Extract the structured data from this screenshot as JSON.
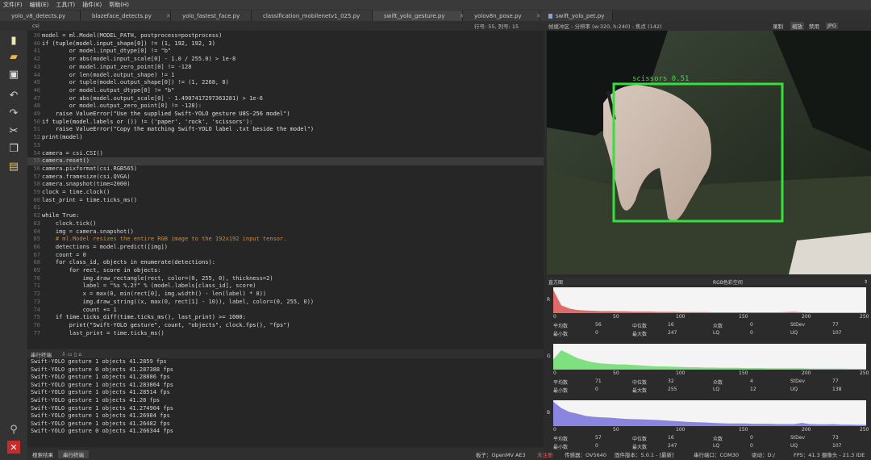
{
  "menu": [
    "文件(F)",
    "编辑(E)",
    "工具(T)",
    "插件(K)",
    "帮助(H)"
  ],
  "tabs": [
    {
      "label": "yolo_v8_detects.py"
    },
    {
      "label": "blazeface_detects.py"
    },
    {
      "label": "yolo_fastest_face.py"
    },
    {
      "label": "classification_mobilenetv1_025.py"
    },
    {
      "label": "swift_yolo_gesture.py"
    },
    {
      "label": "yolov8n_pose.py"
    },
    {
      "label": "swift_yolo_pet.py"
    }
  ],
  "editor_tab": "csi",
  "cursor_info": "行号: 55, 列号: 15",
  "fb_info": "帧缓冲区 - 分辨率 (w:320, h:240) - 焦点 (142)",
  "fb_buttons": [
    "录制",
    "缩放",
    "禁用",
    "JPG"
  ],
  "code_lines": [
    {
      "n": "39",
      "t": "model = ml.Model(MODEL_PATH, postprocess=postprocess)"
    },
    {
      "n": "40",
      "t": "if (tuple(model.input_shape[0]) != (1, 192, 192, 3)"
    },
    {
      "n": "41",
      "t": "        or model.input_dtype[0] != \"b\""
    },
    {
      "n": "42",
      "t": "        or abs(model.input_scale[0] - 1.0 / 255.0) > 1e-8"
    },
    {
      "n": "43",
      "t": "        or model.input_zero_point[0] != -128"
    },
    {
      "n": "44",
      "t": "        or len(model.output_shape) != 1"
    },
    {
      "n": "45",
      "t": "        or tuple(model.output_shape[0]) != (1, 2268, 8)"
    },
    {
      "n": "46",
      "t": "        or model.output_dtype[0] != \"b\""
    },
    {
      "n": "47",
      "t": "        or abs(model.output_scale[0] - 1.4907417297363281) > 1e-6"
    },
    {
      "n": "48",
      "t": "        or model.output_zero_point[0] != -128):"
    },
    {
      "n": "49",
      "t": "    raise ValueError(\"Use the supplied Swift-YOLO gesture U8S-256 model\")"
    },
    {
      "n": "50",
      "t": "if tuple(model.labels or ()) != ('paper', 'rock', 'scissors'):"
    },
    {
      "n": "51",
      "t": "    raise ValueError(\"Copy the matching Swift-YOLO label .txt beside the model\")"
    },
    {
      "n": "52",
      "t": "print(model)"
    },
    {
      "n": "53",
      "t": ""
    },
    {
      "n": "54",
      "t": "camera = csi.CSI()"
    },
    {
      "n": "55",
      "t": "camera.reset()"
    },
    {
      "n": "56",
      "t": "camera.pixformat(csi.RGB565)"
    },
    {
      "n": "57",
      "t": "camera.framesize(csi.QVGA)"
    },
    {
      "n": "58",
      "t": "camera.snapshot(time=2000)"
    },
    {
      "n": "59",
      "t": "clock = time.clock()"
    },
    {
      "n": "60",
      "t": "last_print = time.ticks_ms()"
    },
    {
      "n": "61",
      "t": ""
    },
    {
      "n": "62",
      "t": "while True:"
    },
    {
      "n": "63",
      "t": "    clock.tick()"
    },
    {
      "n": "64",
      "t": "    img = camera.snapshot()"
    },
    {
      "n": "65",
      "t": "    # ml.Model resizes the entire RGB image to the 192x192 input tensor."
    },
    {
      "n": "66",
      "t": "    detections = model.predict([img])"
    },
    {
      "n": "67",
      "t": "    count = 0"
    },
    {
      "n": "68",
      "t": "    for class_id, objects in enumerate(detections):"
    },
    {
      "n": "69",
      "t": "        for rect, score in objects:"
    },
    {
      "n": "70",
      "t": "            img.draw_rectangle(rect, color=(0, 255, 0), thickness=2)"
    },
    {
      "n": "71",
      "t": "            label = \"%s %.2f\" % (model.labels[class_id], score)"
    },
    {
      "n": "72",
      "t": "            x = max(0, min(rect[0], img.width() - len(label) * 8))"
    },
    {
      "n": "73",
      "t": "            img.draw_string((x, max(0, rect[1] - 10)), label, color=(0, 255, 0))"
    },
    {
      "n": "74",
      "t": "            count += 1"
    },
    {
      "n": "75",
      "t": "    if time.ticks_diff(time.ticks_ms(), last_print) >= 1000:"
    },
    {
      "n": "76",
      "t": "        print(\"Swift-YOLO gesture\", count, \"objects\", clock.fps(), \"fps\")"
    },
    {
      "n": "77",
      "t": "        last_print = time.ticks_ms()"
    }
  ],
  "terminal_title": "串行终端",
  "terminal_lines": [
    "Swift-YOLO gesture 1 objects 41.2859 fps",
    "Swift-YOLO gesture 0 objects 41.287388 fps",
    "Swift-YOLO gesture 1 objects 41.28886 fps",
    "Swift-YOLO gesture 1 objects 41.283864 fps",
    "Swift-YOLO gesture 1 objects 41.28514 fps",
    "Swift-YOLO gesture 1 objects 41.28 fps",
    "Swift-YOLO gesture 1 objects 41.274904 fps",
    "Swift-YOLO gesture 1 objects 41.26984 fps",
    "Swift-YOLO gesture 1 objects 41.26482 fps",
    "Swift-YOLO gesture 0 objects 41.266344 fps"
  ],
  "bottom_tabs": [
    "搜索结果",
    "串行终端"
  ],
  "status": {
    "board": "板子：OpenMV AE3",
    "sensor": "传感器：OV5640",
    "firmware": "固件版本：5.0.1 - [最新]",
    "port": "串行端口：COM30",
    "drive": "驱动：D:/",
    "fps": "FPS：41.3 摄像头 - 21.3 IDE",
    "unreg": "未注册"
  },
  "detection_label": "scissors 0.51",
  "hist_title": "直方图",
  "colorspace": "RGB色彩空间",
  "axis_ticks": [
    "0",
    "50",
    "100",
    "150",
    "200",
    "250"
  ],
  "channels": [
    {
      "ch": "R",
      "color": "#e06a6a",
      "row1": [
        "平均数",
        "56",
        "中位数",
        "16",
        "众数",
        "0",
        "StDev",
        "77"
      ],
      "row2": [
        "最小数",
        "0",
        "最大数",
        "247",
        "LQ",
        "0",
        "UQ",
        "107"
      ]
    },
    {
      "ch": "G",
      "color": "#7ee07e",
      "row1": [
        "平均数",
        "71",
        "中位数",
        "32",
        "众数",
        "4",
        "StDev",
        "77"
      ],
      "row2": [
        "最小数",
        "0",
        "最大数",
        "255",
        "LQ",
        "12",
        "UQ",
        "138"
      ]
    },
    {
      "ch": "B",
      "color": "#8a86e0",
      "row1": [
        "平均数",
        "57",
        "中位数",
        "16",
        "众数",
        "0",
        "StDev",
        "73"
      ],
      "row2": [
        "最小数",
        "0",
        "最大数",
        "247",
        "LQ",
        "0",
        "UQ",
        "107"
      ]
    }
  ]
}
